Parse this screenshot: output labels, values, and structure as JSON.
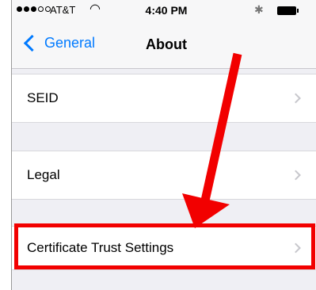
{
  "status_bar": {
    "carrier": "AT&T",
    "time": "4:40 PM",
    "wifi_icon": "wifi-icon",
    "bluetooth_icon": "bluetooth-icon",
    "battery_icon": "battery-icon"
  },
  "nav": {
    "back_label": "General",
    "title": "About"
  },
  "rows": [
    {
      "label": "SEID"
    },
    {
      "label": "Legal"
    },
    {
      "label": "Certificate Trust Settings"
    }
  ],
  "colors": {
    "accent": "#007aff",
    "highlight": "#f20000",
    "background": "#efeff4"
  }
}
